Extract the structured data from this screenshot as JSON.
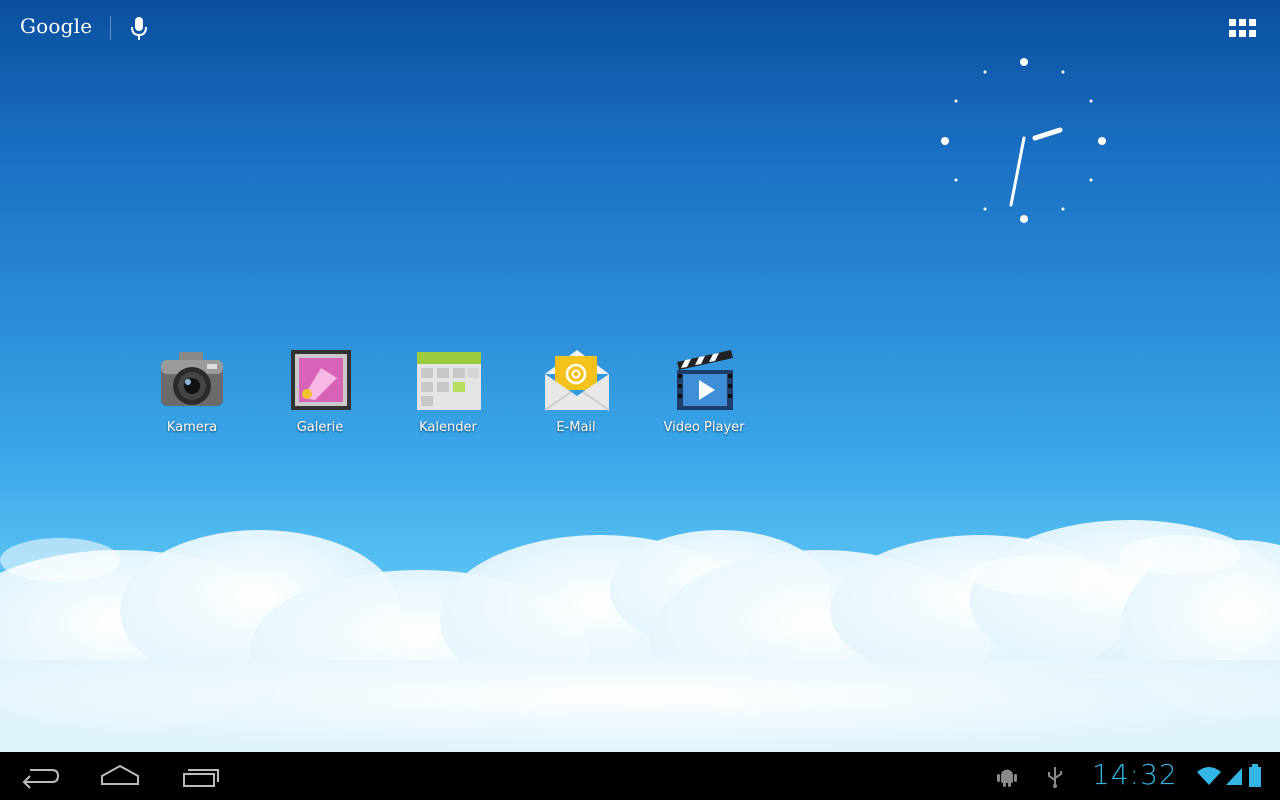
{
  "topbar": {
    "search_logo": "Google",
    "icons": {
      "voice": "microphone-icon",
      "apps": "all-apps-grid-icon"
    }
  },
  "clock_widget": {
    "type": "analog-clock",
    "hour": 14,
    "minute": 32
  },
  "apps": [
    {
      "label": "Kamera",
      "icon": "camera-icon"
    },
    {
      "label": "Galerie",
      "icon": "gallery-icon"
    },
    {
      "label": "Kalender",
      "icon": "calendar-icon"
    },
    {
      "label": "E-Mail",
      "icon": "email-icon"
    },
    {
      "label": "Video Player",
      "icon": "video-player-icon"
    }
  ],
  "systembar": {
    "time": "14:32",
    "nav": {
      "back": "back-icon",
      "home": "home-icon",
      "recents": "recent-apps-icon"
    },
    "status_icons": [
      "android-debug-icon",
      "usb-icon",
      "wifi-icon",
      "signal-icon",
      "battery-icon"
    ],
    "accent_color": "#33b5e5"
  }
}
